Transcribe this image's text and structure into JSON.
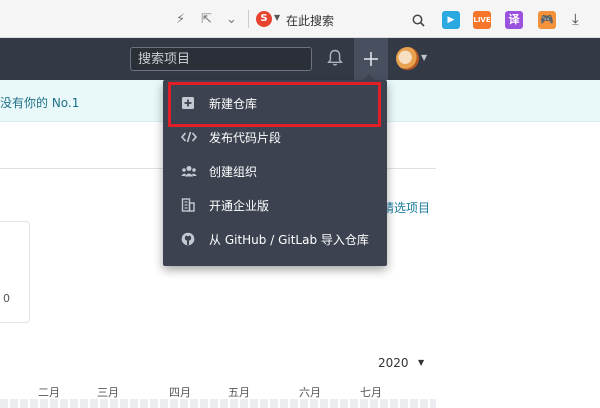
{
  "browser": {
    "search_engine_text": "在此搜索",
    "extensions": {
      "live": "LIVE",
      "translate": "译"
    }
  },
  "header": {
    "search_placeholder": "搜索项目"
  },
  "banner": {
    "text": "没有你的 No.1"
  },
  "content": {
    "featured_link": "精选项目",
    "card_value": "0",
    "year": "2020",
    "months": [
      "二月",
      "三月",
      "四月",
      "五月",
      "六月",
      "七月"
    ]
  },
  "dropdown": {
    "items": [
      {
        "label": "新建仓库",
        "icon": "plus-square-icon"
      },
      {
        "label": "发布代码片段",
        "icon": "code-icon"
      },
      {
        "label": "创建组织",
        "icon": "people-icon"
      },
      {
        "label": "开通企业版",
        "icon": "building-icon"
      },
      {
        "label": "从 GitHub / GitLab 导入仓库",
        "icon": "github-icon"
      }
    ]
  },
  "colors": {
    "header_bg": "#333a45",
    "dropdown_bg": "#3c4250",
    "highlight": "#e11f26",
    "banner_bg": "#e9f9fa"
  }
}
